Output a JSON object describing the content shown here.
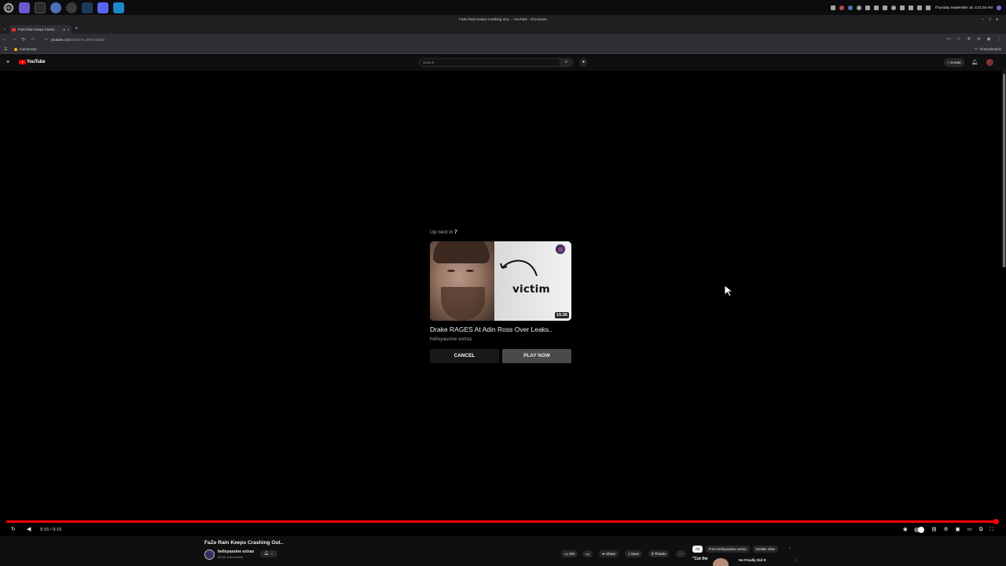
{
  "os": {
    "apps": [
      "mint-menu",
      "files",
      "terminal",
      "chromium",
      "software-manager",
      "steam",
      "discord",
      "edge"
    ],
    "clock": "Thursday September 18, 2:21:54 AM"
  },
  "browser": {
    "window_title": "FaZe Rain Keeps Crashing Out.. - YouTube - Chromium",
    "tab_title": "FaZe Rain Keeps Crashi...",
    "tab_close": "×",
    "new_tab": "+",
    "url_domain": "youtube.com",
    "url_path": "/watch?v=dWe-fZ3B0t",
    "bookmark": "Community",
    "all_bookmarks": "All Bookmarks"
  },
  "youtube": {
    "search_placeholder": "Search",
    "create_label": "Create",
    "logo_text": "YouTube"
  },
  "endscreen": {
    "up_next_prefix": "Up next in",
    "countdown": "7",
    "thumb_word": "victim",
    "duration": "15:26",
    "title": "Drake RAGES At Adin Ross Over Leaks..",
    "channel": "helloyassine extras",
    "cancel_label": "CANCEL",
    "play_label": "PLAY NOW"
  },
  "player": {
    "time": "9:15 / 9:15",
    "progress": 1.0
  },
  "below": {
    "video_title": "FaZe Rain Keeps Crashing Out..",
    "owner_name": "helloyassine extras",
    "owner_subs": "60.5K subscribers",
    "likes": "204",
    "share_label": "Share",
    "save_label": "Save",
    "thanks_label": "Thanks",
    "chips": [
      "All",
      "From helloyassine extras",
      "Nordan Shat"
    ],
    "rec_thumb_text": "\"Cut the",
    "rec_title": "He Finally Did It"
  },
  "colors": {
    "accent": "#ff0000",
    "background": "#000000"
  }
}
